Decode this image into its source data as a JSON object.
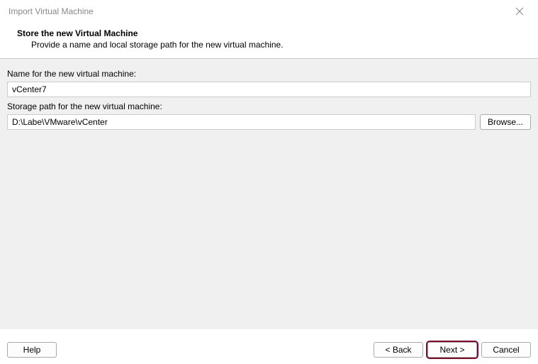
{
  "titlebar": {
    "title": "Import Virtual Machine"
  },
  "header": {
    "title": "Store the new Virtual Machine",
    "subtitle": "Provide a name and local storage path for the new virtual machine."
  },
  "fields": {
    "name_label": "Name for the new virtual machine:",
    "name_value": "vCenter7",
    "path_label": "Storage path for the new virtual machine:",
    "path_value": "D:\\Labe\\VMware\\vCenter",
    "browse_label": "Browse..."
  },
  "footer": {
    "help": "Help",
    "back": "< Back",
    "next": "Next >",
    "cancel": "Cancel"
  }
}
